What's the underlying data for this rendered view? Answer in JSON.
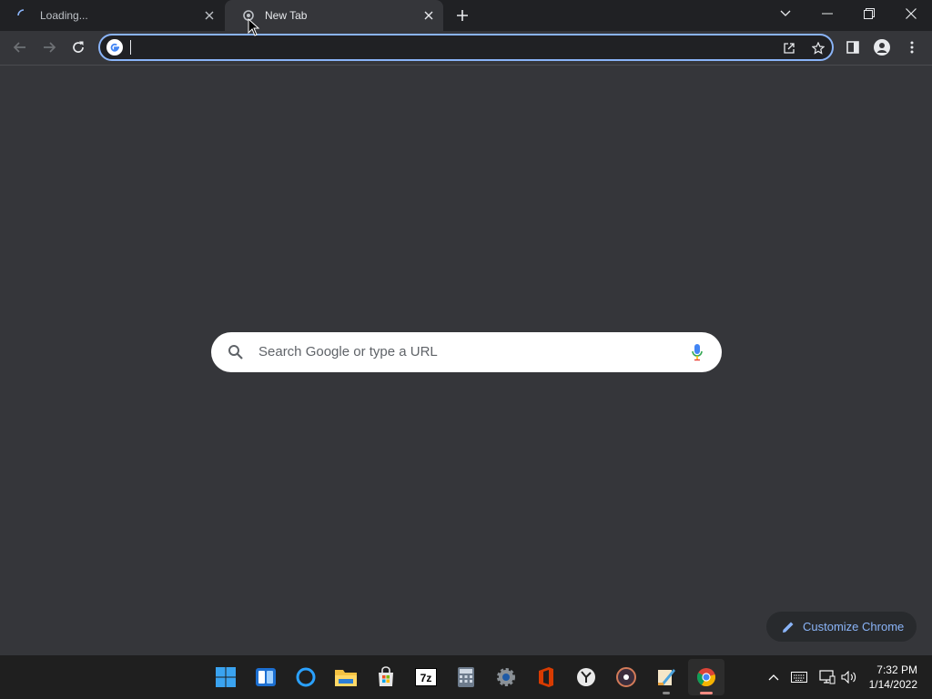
{
  "tabs": [
    {
      "title": "Loading...",
      "state": "loading",
      "active": false
    },
    {
      "title": "New Tab",
      "state": "loaded",
      "active": true
    }
  ],
  "omnibox": {
    "value": "",
    "placeholder": ""
  },
  "search": {
    "placeholder": "Search Google or type a URL"
  },
  "customize": {
    "label": "Customize Chrome"
  },
  "clock": {
    "time": "7:32 PM",
    "date": "1/14/2022"
  },
  "taskbar_apps": [
    "windows-start",
    "widgets",
    "cortana",
    "file-explorer",
    "microsoft-store",
    "7zip",
    "calculator",
    "settings",
    "office",
    "clock",
    "media-player",
    "paint-app",
    "chrome"
  ],
  "colors": {
    "accent": "#8ab4f8",
    "frame": "#202124",
    "toolbar": "#35363a",
    "page": "#35363a",
    "taskbar": "#1f1f1f"
  }
}
